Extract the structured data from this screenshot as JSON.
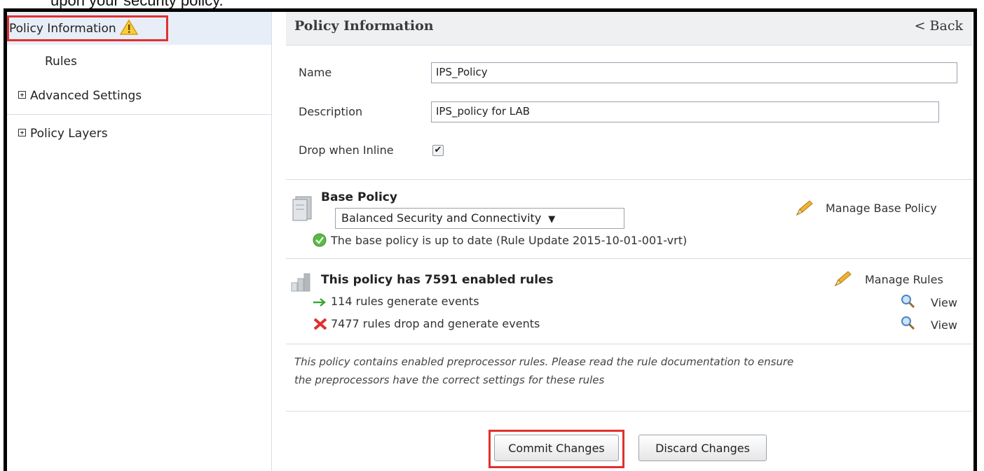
{
  "caption_fragment": "upon your security policy.",
  "sidebar": {
    "items": [
      {
        "label": "Policy Information",
        "icon": "warning-icon"
      },
      {
        "label": "Rules"
      },
      {
        "label": "Advanced Settings",
        "icon": "plus-box-icon"
      },
      {
        "label": "Policy Layers",
        "icon": "plus-box-icon"
      }
    ]
  },
  "header": {
    "title": "Policy Information",
    "back_label": "< Back"
  },
  "form": {
    "name_label": "Name",
    "name_value": "IPS_Policy",
    "description_label": "Description",
    "description_value": "IPS_policy for LAB",
    "drop_label": "Drop when Inline",
    "drop_checked": true
  },
  "base_policy": {
    "title": "Base Policy",
    "selected": "Balanced Security and Connectivity",
    "manage_label": "Manage Base Policy",
    "status": "The base policy is up to date (Rule Update 2015-10-01-001-vrt)"
  },
  "rules": {
    "summary": "This policy has 7591 enabled rules",
    "manage_label": "Manage Rules",
    "generate_text": "114 rules generate events",
    "drop_text": "7477 rules drop and generate events",
    "view_label": "View"
  },
  "note": {
    "line1": "This policy contains enabled preprocessor rules. Please read the rule documentation to ensure",
    "line2": "the preprocessors have the correct settings for these rules"
  },
  "buttons": {
    "commit": "Commit Changes",
    "discard": "Discard Changes"
  },
  "colors": {
    "highlight_box": "#e0312f",
    "sidebar_active": "#e8eef7",
    "header_bg": "#eef0f2"
  }
}
